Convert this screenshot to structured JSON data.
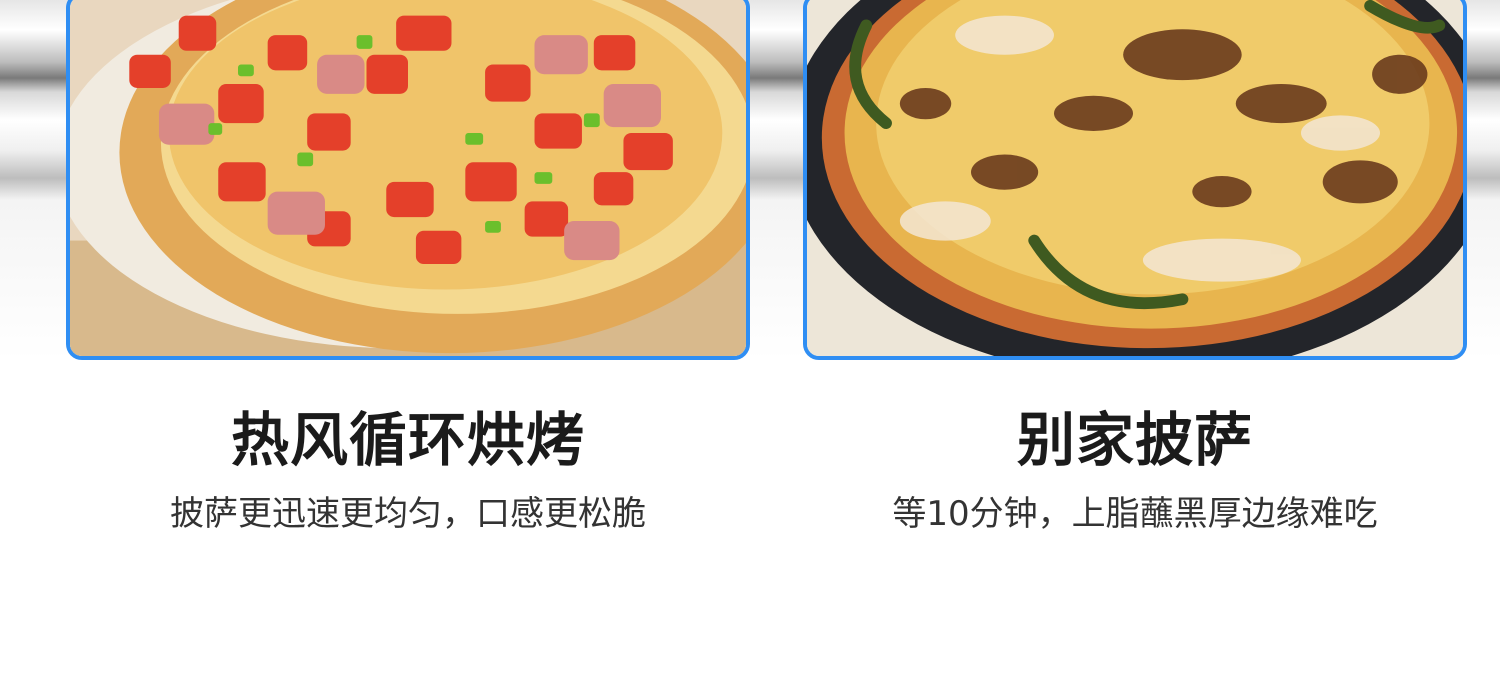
{
  "left": {
    "title": "热风循环烘烤",
    "subtitle": "披萨更迅速更均匀，口感更松脆",
    "image_icon": "pizza-photo-icon"
  },
  "right": {
    "title": "别家披萨",
    "subtitle": "等10分钟，上脂蘸黑厚边缘难吃",
    "image_icon": "burnt-pizza-photo-icon"
  },
  "colors": {
    "accent_border": "#2f8ef3",
    "title_text": "#1b1b1b",
    "subtitle_text": "#333333"
  }
}
